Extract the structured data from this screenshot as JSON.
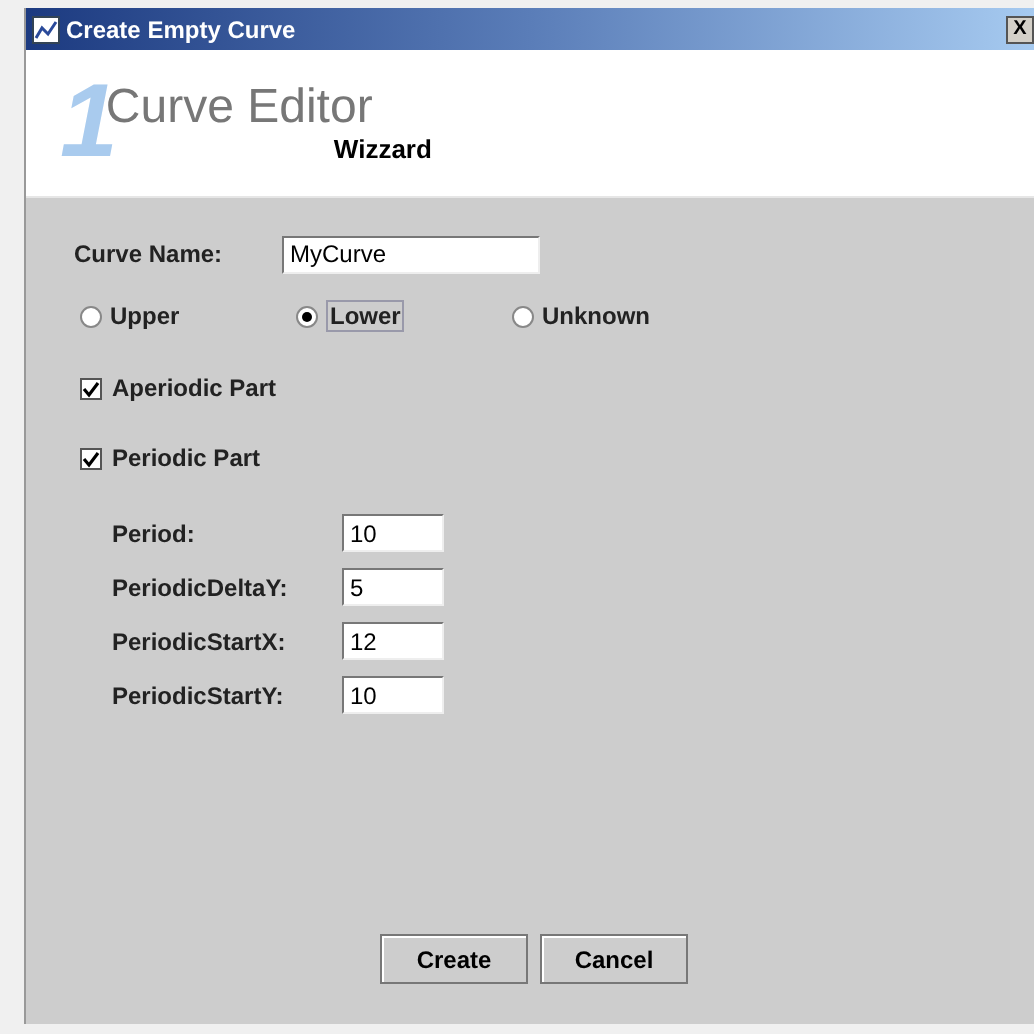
{
  "window": {
    "title": "Create Empty Curve",
    "close": "X"
  },
  "header": {
    "logo_digit": "1",
    "title": "Curve Editor",
    "subtitle": "Wizzard"
  },
  "curve_name": {
    "label": "Curve Name:",
    "value": "MyCurve"
  },
  "radios": [
    {
      "label": "Upper",
      "selected": false
    },
    {
      "label": "Lower",
      "selected": true
    },
    {
      "label": "Unknown",
      "selected": false
    }
  ],
  "checkboxes": [
    {
      "label": "Aperiodic Part",
      "checked": true
    },
    {
      "label": "Periodic Part",
      "checked": true
    }
  ],
  "fields": [
    {
      "label": "Period:",
      "value": "10"
    },
    {
      "label": "PeriodicDeltaY:",
      "value": "5"
    },
    {
      "label": "PeriodicStartX:",
      "value": "12"
    },
    {
      "label": "PeriodicStartY:",
      "value": "10"
    }
  ],
  "buttons": [
    "Create",
    "Cancel"
  ]
}
